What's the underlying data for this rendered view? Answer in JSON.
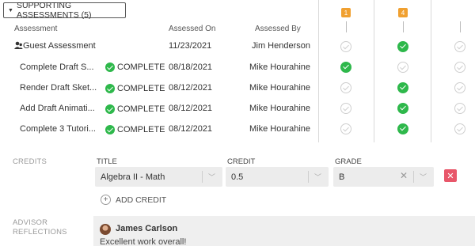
{
  "section": {
    "toggle_label": "SUPPORTING ASSESSMENTS (5)"
  },
  "columns": {
    "assessment": "Assessment",
    "assessed_on": "Assessed On",
    "assessed_by": "Assessed By"
  },
  "badges": [
    "1",
    "4"
  ],
  "rows": [
    {
      "name": "Guest Assessment",
      "status": "",
      "date": "11/23/2021",
      "by": "Jim Henderson",
      "checks": [
        "empty",
        "done",
        "empty"
      ]
    },
    {
      "name": "Complete Draft S...",
      "status": "COMPLETE",
      "date": "08/18/2021",
      "by": "Mike Hourahine",
      "checks": [
        "done",
        "empty",
        "empty"
      ]
    },
    {
      "name": "Render Draft Sket...",
      "status": "COMPLETE",
      "date": "08/12/2021",
      "by": "Mike Hourahine",
      "checks": [
        "empty",
        "done",
        "empty"
      ]
    },
    {
      "name": "Add Draft Animati...",
      "status": "COMPLETE",
      "date": "08/12/2021",
      "by": "Mike Hourahine",
      "checks": [
        "empty",
        "done",
        "empty"
      ]
    },
    {
      "name": "Complete 3 Tutori...",
      "status": "COMPLETE",
      "date": "08/12/2021",
      "by": "Mike Hourahine",
      "checks": [
        "empty",
        "done",
        "empty"
      ]
    }
  ],
  "credits": {
    "section_label": "CREDITS",
    "title_label": "TITLE",
    "title_value": "Algebra II - Math",
    "credit_label": "CREDIT",
    "credit_value": "0.5",
    "grade_label": "GRADE",
    "grade_value": "B",
    "add_label": "ADD CREDIT"
  },
  "reflections": {
    "section_label_line1": "ADVISOR",
    "section_label_line2": "REFLECTIONS",
    "author": "James Carlson",
    "text": "Excellent work overall!"
  },
  "colors": {
    "complete_green": "#2eb84b",
    "badge_orange": "#f0a030",
    "delete_red": "#e8576a"
  }
}
